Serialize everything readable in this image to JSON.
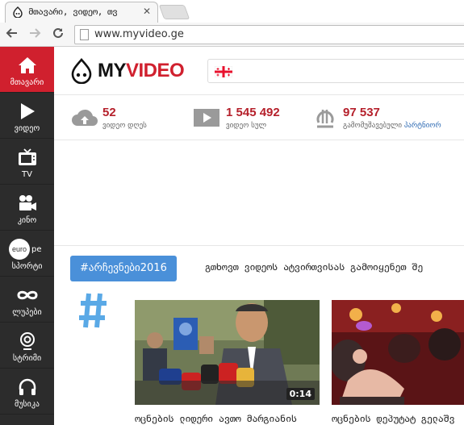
{
  "browser": {
    "tab_title": "მთავარი, ვიდეო, თვ",
    "tab_close": "✕",
    "url": "www.myvideo.ge",
    "back_icon": "arrow-left-icon",
    "forward_icon": "arrow-right-icon",
    "reload_icon": "reload-icon"
  },
  "sidebar": {
    "items": [
      {
        "label": "მთავარი",
        "icon": "home-icon",
        "active": true
      },
      {
        "label": "ვიდეო",
        "icon": "play-icon",
        "active": false
      },
      {
        "label": "TV",
        "icon": "tv-icon",
        "active": false
      },
      {
        "label": "კინო",
        "icon": "camera-icon",
        "active": false
      },
      {
        "label": "სპორტი",
        "icon": "euronews-icon",
        "active": false,
        "badge": "euro"
      },
      {
        "label": "ლუპები",
        "icon": "infinity-icon",
        "active": false
      },
      {
        "label": "სტრიმი",
        "icon": "stream-icon",
        "active": false
      },
      {
        "label": "მუსიკა",
        "icon": "headphones-icon",
        "active": false
      }
    ],
    "sport_badge_text": "euro",
    "sport_badge_suffix": "pe"
  },
  "header": {
    "logo_my": "MY",
    "logo_video": "VIDEO"
  },
  "stats": [
    {
      "value": "52",
      "label": "ვიდეო დღეს",
      "icon": "cloud-upload-icon"
    },
    {
      "value": "1 545 492",
      "label": "ვიდეო სულ",
      "icon": "video-player-icon"
    },
    {
      "value": "97 537",
      "label": "გამომუშავებული ",
      "label_link": "პარტნიორ",
      "icon": "lari-icon"
    }
  ],
  "tags": {
    "button": "#არჩევნები2016",
    "text": "გთხოვთ ვიდეოს ატვირთვისას გამოიყენეთ შე"
  },
  "videos": [
    {
      "title": "ოცნების ლიდერი ავთო მარგიანის",
      "duration": "0:14"
    },
    {
      "title": "ოცნების დეპუტატ გელაშვ",
      "duration": ""
    }
  ],
  "colors": {
    "brand_red": "#d0202e",
    "sidebar_bg": "#2c2c2c",
    "hashtag_blue": "#4a90d9",
    "stat_red": "#b5202b"
  }
}
